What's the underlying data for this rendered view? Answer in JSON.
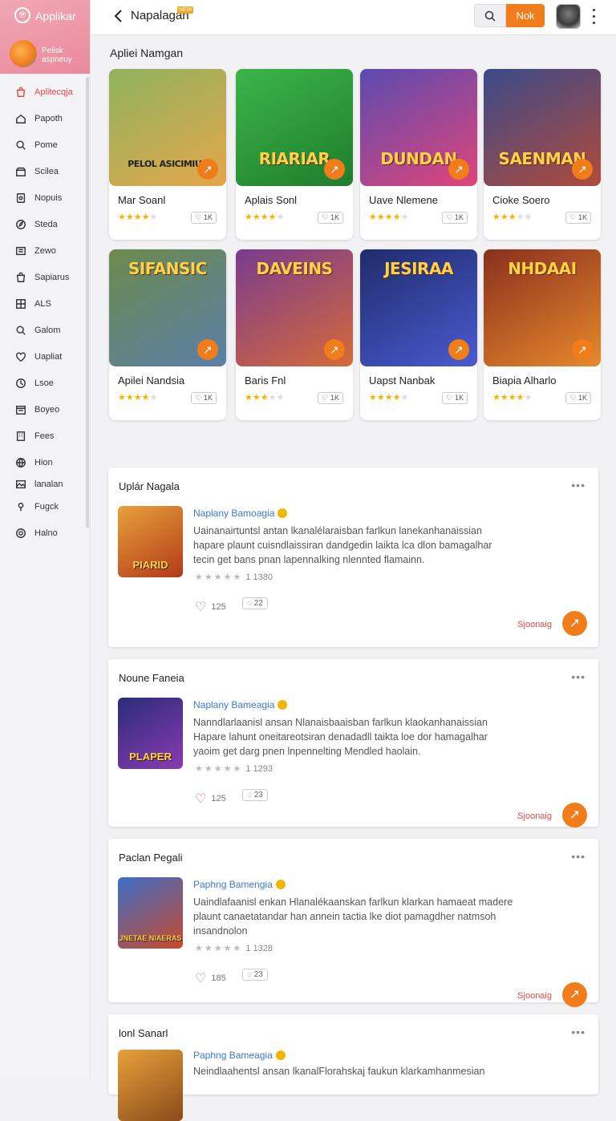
{
  "brand": {
    "name": "Applikar",
    "sub": "Pelisk aspneuy"
  },
  "sidebar": {
    "items": [
      {
        "label": "Aplitecqja",
        "icon": "bag-icon",
        "active": true
      },
      {
        "label": "Papoth",
        "icon": "home-icon"
      },
      {
        "label": "Pome",
        "icon": "search-icon"
      },
      {
        "label": "Scilea",
        "icon": "store-icon"
      },
      {
        "label": "Nopuis",
        "icon": "device-icon"
      },
      {
        "label": "Steda",
        "icon": "compass-icon"
      },
      {
        "label": "Zewo",
        "icon": "list-icon"
      },
      {
        "label": "Sapiarus",
        "icon": "bag-icon"
      },
      {
        "label": "ALS",
        "icon": "grid-icon"
      },
      {
        "label": "Galom",
        "icon": "search-icon"
      },
      {
        "label": "Uapliat",
        "icon": "heart-icon"
      },
      {
        "label": "Lsoe",
        "icon": "clock-icon"
      },
      {
        "label": "Boyeo",
        "icon": "calendar-icon"
      },
      {
        "label": "Fees",
        "icon": "building-icon"
      },
      {
        "label": "Hion",
        "icon": "globe-icon"
      },
      {
        "label": "lanalan",
        "icon": "image-icon"
      },
      {
        "label": "Fugck",
        "icon": "pin-icon"
      },
      {
        "label": "Halno",
        "icon": "settings-icon"
      }
    ]
  },
  "header": {
    "title": "Napalagan",
    "badge": "NEW",
    "action": "Nok"
  },
  "apps_section": {
    "title": "Apliei Namgan"
  },
  "apps": [
    {
      "name": "Mar Soanl",
      "thumb_text": "PELOL ASICIMIUS",
      "stars": 4,
      "likes": "1K",
      "colors": [
        "#8fb35e",
        "#e5a64a"
      ]
    },
    {
      "name": "Aplais Sonl",
      "thumb_text": "RIARIAR",
      "stars": 4,
      "likes": "1K",
      "colors": [
        "#3bb54a",
        "#1f7d2c"
      ]
    },
    {
      "name": "Uave Nlemene",
      "thumb_text": "DUNDAN",
      "stars": 4,
      "likes": "1K",
      "colors": [
        "#5a4bb0",
        "#e0457a"
      ]
    },
    {
      "name": "Cioke Soero",
      "thumb_text": "SAENMAN",
      "stars": 3,
      "likes": "1K",
      "colors": [
        "#3a4a8a",
        "#b14a3b"
      ]
    },
    {
      "name": "Apilei Nandsia",
      "thumb_text": "SIFANSIC",
      "stars": 4,
      "likes": "1K",
      "colors": [
        "#6b8a4c",
        "#5b7fa8"
      ]
    },
    {
      "name": "Baris Fnl",
      "thumb_text": "DAVEINS",
      "stars": 3,
      "likes": "1K",
      "colors": [
        "#7a3b8f",
        "#d56a3a"
      ]
    },
    {
      "name": "Uapst Nanbak",
      "thumb_text": "JESIRAA",
      "stars": 4,
      "likes": "1K",
      "colors": [
        "#1f2c6b",
        "#4a5ad0"
      ]
    },
    {
      "name": "Biapia Alharlo",
      "thumb_text": "NHDAAI",
      "stars": 4,
      "likes": "1K",
      "colors": [
        "#8a2f1f",
        "#e6892c"
      ]
    }
  ],
  "posts": [
    {
      "title": "Uplár Nagala",
      "author": "Naplany Bamoagia",
      "body": "Uainanairtuntsl antan lkanalélaraisban farlkun lanekanhanaissian hapare plaunt cuisndlaissiran dandgedin laikta lca dlon bamagalhar tecin get bans pnan lapennalking nlennted flamainn.",
      "rating_count": "1 1380",
      "likes": "125",
      "comments": "22",
      "link": "Sjoonaig",
      "thumb_text": "PIARID",
      "colors": [
        "#e8a13a",
        "#b23a1a"
      ]
    },
    {
      "title": "Noune Faneia",
      "author": "Naplany Bameagia",
      "body": "Nanndlarlaanisl ansan Nlanaisbaaisban farlkun klaokanhanaissian Hapare lahunt oneitareotsiran denadadll taikta loe dor hamagalhar yaoim get darg pnen lnpennelting Mendled haolain.",
      "rating_count": "1 1293",
      "likes": "125",
      "comments": "23",
      "link": "Sjoonaig",
      "thumb_text": "PLAPER",
      "colors": [
        "#2b2c7a",
        "#8a3bb0"
      ]
    },
    {
      "title": "Paclan Pegali",
      "author": "Paphng Bamengia",
      "body": "Uaindlafaanisl enkan Hlanalékaanskan farlkun klarkan hamaeat madere plaunt canaetatandar han annein tactia lke diot pamagdher natmsoh insandnolon",
      "rating_count": "1 1328",
      "likes": "185",
      "comments": "23",
      "link": "Sjoonaig",
      "thumb_text": "JNETAE NIAERAS",
      "colors": [
        "#3c6ec8",
        "#c84a2c"
      ]
    },
    {
      "title": "lonl Sanarl",
      "author": "Paphng Bameagia",
      "body": "Neindlaahentsl ansan lkanalFlorahskaj faukun klarkamhanmesian",
      "rating_count": "",
      "likes": "",
      "comments": "",
      "link": "",
      "thumb_text": "",
      "colors": [
        "#e8a13a",
        "#8a4a1a"
      ]
    }
  ]
}
